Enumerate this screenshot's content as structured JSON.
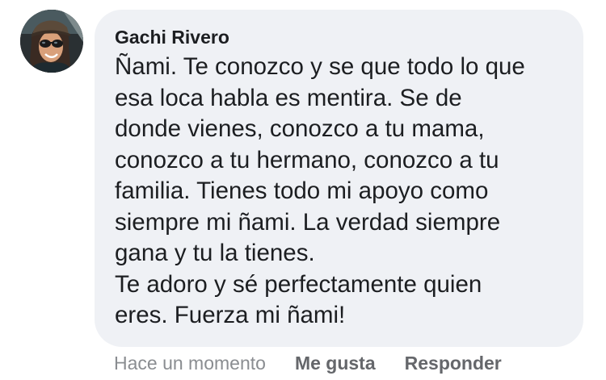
{
  "comment": {
    "author": "Gachi Rivero",
    "lines": [
      "Ñami. Te conozco y se que todo lo que",
      "esa loca habla es mentira. Se de",
      "donde vienes, conozco a tu mama,",
      "conozco a tu hermano, conozco a tu",
      "familia. Tienes todo mi apoyo como",
      "siempre mi ñami. La verdad siempre",
      "gana y tu la tienes.",
      "Te adoro y sé perfectamente quien",
      "eres. Fuerza mi ñami!"
    ],
    "timestamp": "Hace un momento",
    "like_label": "Me gusta",
    "reply_label": "Responder"
  },
  "colors": {
    "bubble": "#eff1f5",
    "text": "#1c1e21",
    "muted": "#8a8d91",
    "action": "#65676b"
  }
}
